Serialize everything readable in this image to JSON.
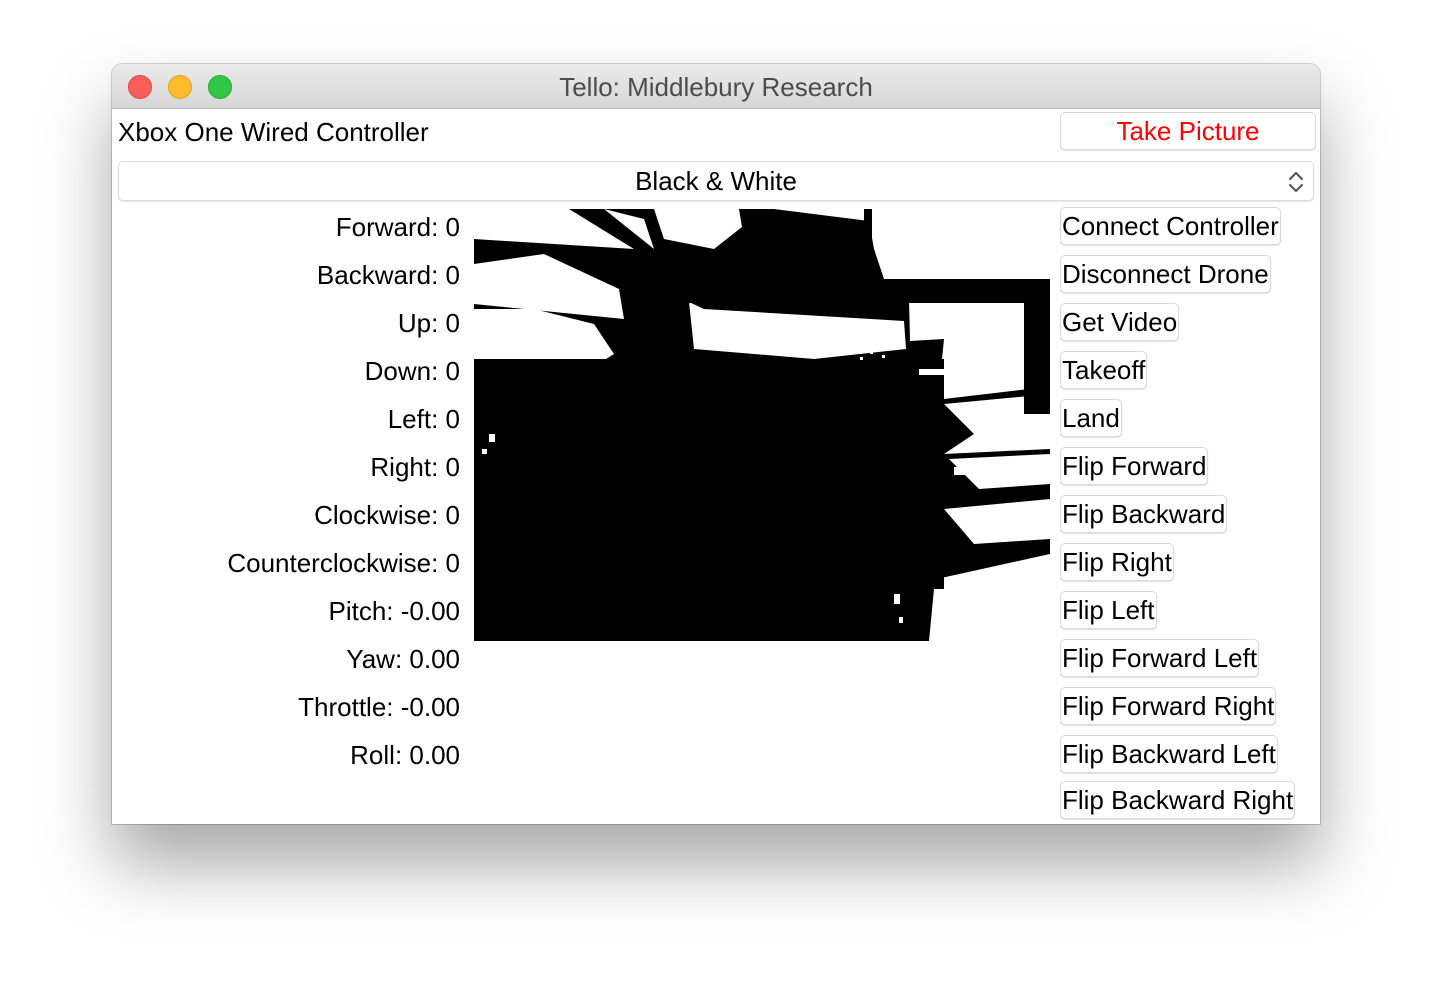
{
  "window": {
    "title": "Tello: Middlebury Research"
  },
  "header": {
    "controller_name": "Xbox One Wired Controller",
    "take_picture_label": "Take Picture",
    "take_picture_color": "#ff0000"
  },
  "filter": {
    "selected": "Black & White"
  },
  "stats": [
    {
      "label": "Forward: 0"
    },
    {
      "label": "Backward: 0"
    },
    {
      "label": "Up: 0"
    },
    {
      "label": "Down: 0"
    },
    {
      "label": "Left: 0"
    },
    {
      "label": "Right: 0"
    },
    {
      "label": "Clockwise: 0"
    },
    {
      "label": "Counterclockwise: 0"
    },
    {
      "label": "Pitch: -0.00"
    },
    {
      "label": "Yaw: 0.00"
    },
    {
      "label": "Throttle: -0.00"
    },
    {
      "label": "Roll: 0.00"
    }
  ],
  "commands": [
    {
      "label": "Connect Controller"
    },
    {
      "label": "Disconnect Drone"
    },
    {
      "label": "Get Video"
    },
    {
      "label": "Takeoff"
    },
    {
      "label": "Land"
    },
    {
      "label": "Flip Forward"
    },
    {
      "label": "Flip Backward"
    },
    {
      "label": "Flip Right"
    },
    {
      "label": "Flip Left"
    },
    {
      "label": "Flip Forward Left"
    },
    {
      "label": "Flip Forward Right"
    },
    {
      "label": "Flip Backward Left"
    },
    {
      "label": "Flip Backward Right"
    }
  ],
  "icons": {
    "window_controls": [
      "close-icon",
      "minimize-icon",
      "zoom-icon"
    ],
    "select_arrows": "chevron-up-down-icon"
  }
}
